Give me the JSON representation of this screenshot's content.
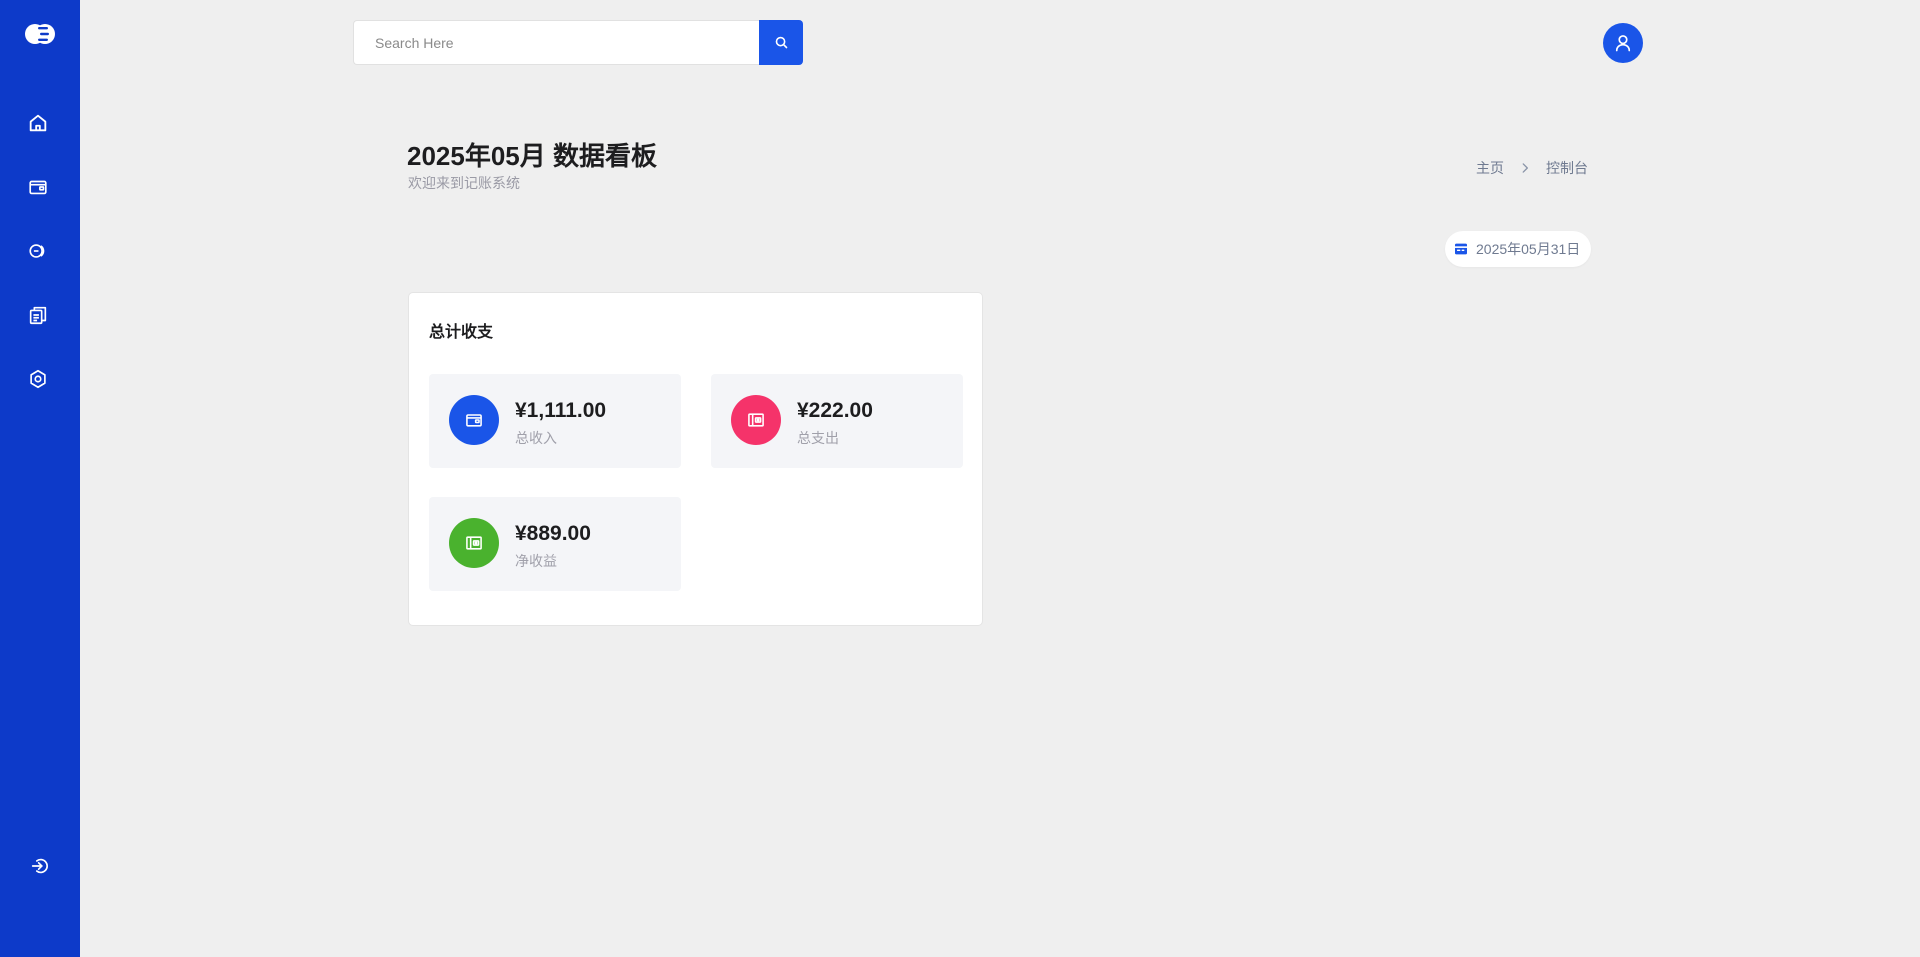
{
  "sidebar": {
    "logo": "logo-icon",
    "items": [
      {
        "name": "home",
        "icon": "home-icon"
      },
      {
        "name": "wallet",
        "icon": "wallet-icon"
      },
      {
        "name": "coins",
        "icon": "coins-icon"
      },
      {
        "name": "records",
        "icon": "documents-icon"
      },
      {
        "name": "settings",
        "icon": "gear-icon"
      }
    ],
    "logout": "logout-icon"
  },
  "topbar": {
    "search_placeholder": "Search Here",
    "search_icon": "search-icon",
    "avatar_icon": "user-icon"
  },
  "header": {
    "title": "2025年05月 数据看板",
    "subtitle": "欢迎来到记账系统",
    "breadcrumb": [
      "主页",
      "控制台"
    ],
    "date": "2025年05月31日"
  },
  "summary": {
    "title": "总计收支",
    "stats": [
      {
        "value": "¥1,111.00",
        "label": "总收入",
        "color": "#1a55e8",
        "icon": "wallet-icon"
      },
      {
        "value": "¥222.00",
        "label": "总支出",
        "color": "#f5336a",
        "icon": "card-wallet-icon"
      },
      {
        "value": "¥889.00",
        "label": "净收益",
        "color": "#4ab22e",
        "icon": "card-wallet-icon"
      }
    ]
  },
  "colors": {
    "sidebar": "#0d3ac9",
    "accent": "#1a55e8",
    "background": "#efefef"
  }
}
